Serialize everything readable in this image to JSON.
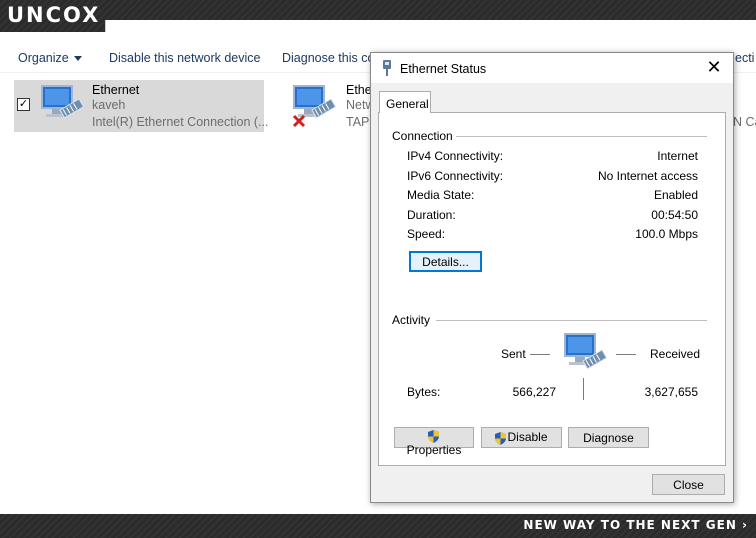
{
  "banner": {
    "brand": "UNCOX",
    "slogan": "NEW WAY TO THE NEXT GEN ›"
  },
  "toolbar": {
    "organize": "Organize",
    "disable_device": "Disable this network device",
    "diagnose": "Diagnose this co",
    "clipped_right": "ecti"
  },
  "adapters": [
    {
      "name": "Ethernet",
      "sub1": "kaveh",
      "sub2": "Intel(R) Ethernet Connection (..."
    },
    {
      "name": "Ether",
      "sub1": "Netw",
      "sub2": "TAP-",
      "right_clip": "N Car"
    }
  ],
  "dialog": {
    "title": "Ethernet Status",
    "tab": "General",
    "connection_label": "Connection",
    "rows": [
      {
        "label": "IPv4 Connectivity:",
        "value": "Internet"
      },
      {
        "label": "IPv6 Connectivity:",
        "value": "No Internet access"
      },
      {
        "label": "Media State:",
        "value": "Enabled"
      },
      {
        "label": "Duration:",
        "value": "00:54:50"
      },
      {
        "label": "Speed:",
        "value": "100.0 Mbps"
      }
    ],
    "details_button": "Details...",
    "activity_label": "Activity",
    "sent_label": "Sent",
    "received_label": "Received",
    "bytes_label": "Bytes:",
    "bytes_sent": "566,227",
    "bytes_received": "3,627,655",
    "properties_button": "Properties",
    "disable_button": "Disable",
    "diagnose_button": "Diagnose",
    "close_button": "Close"
  },
  "colors": {
    "toolbar_text": "#1e3966",
    "selected_bg": "#d9d9d9",
    "focus_border": "#0078d7"
  },
  "icons": [
    "network-adapter-icon",
    "disconnected-x-icon",
    "network-status-icon",
    "uac-shield-icon",
    "close-icon",
    "chevron-down-icon"
  ]
}
